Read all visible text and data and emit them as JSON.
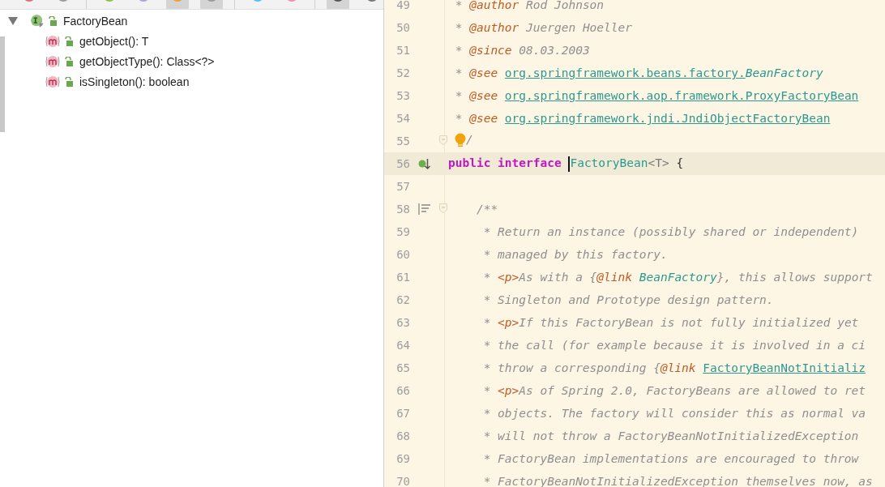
{
  "structure_toolbar": [
    {
      "kind": "circle",
      "selected": false
    },
    {
      "kind": "circle",
      "selected": false
    },
    {
      "kind": "circle",
      "selected": false
    },
    {
      "kind": "circle",
      "selected": false
    },
    {
      "kind": "circle",
      "selected": true
    },
    {
      "kind": "circle",
      "selected": true
    },
    {
      "kind": "circle",
      "selected": false
    },
    {
      "kind": "circle",
      "selected": false
    },
    {
      "kind": "circle",
      "selected": true
    },
    {
      "kind": "circle",
      "selected": false
    }
  ],
  "structure": {
    "label": "FactoryBean",
    "kind": "interface",
    "expanded": true,
    "children": [
      {
        "label": "getObject(): T",
        "kind": "method"
      },
      {
        "label": "getObjectType(): Class<?>",
        "kind": "method"
      },
      {
        "label": "isSingleton(): boolean",
        "kind": "method"
      }
    ]
  },
  "editor": {
    "lines": [
      {
        "number": "49",
        "current": false,
        "fold": false,
        "segments": [
          {
            "kind": "comment",
            "text": " * "
          },
          {
            "kind": "tag",
            "text": "@author"
          },
          {
            "kind": "comment",
            "text": " Rod Johnson"
          }
        ]
      },
      {
        "number": "50",
        "current": false,
        "fold": false,
        "segments": [
          {
            "kind": "comment",
            "text": " * "
          },
          {
            "kind": "tag",
            "text": "@author"
          },
          {
            "kind": "comment",
            "text": " Juergen Hoeller"
          }
        ]
      },
      {
        "number": "51",
        "current": false,
        "fold": false,
        "segments": [
          {
            "kind": "comment",
            "text": " * "
          },
          {
            "kind": "tag",
            "text": "@since"
          },
          {
            "kind": "comment",
            "text": " 08.03.2003"
          }
        ]
      },
      {
        "number": "52",
        "current": false,
        "fold": false,
        "segments": [
          {
            "kind": "comment",
            "text": " * "
          },
          {
            "kind": "tag",
            "text": "@see "
          },
          {
            "kind": "link",
            "text": "org.springframework.beans.factory."
          },
          {
            "kind": "ref",
            "text": "BeanFactory"
          }
        ]
      },
      {
        "number": "53",
        "current": false,
        "fold": false,
        "segments": [
          {
            "kind": "comment",
            "text": " * "
          },
          {
            "kind": "tag",
            "text": "@see "
          },
          {
            "kind": "link",
            "text": "org.springframework.aop.framework.ProxyFactoryBean"
          }
        ]
      },
      {
        "number": "54",
        "current": false,
        "fold": false,
        "segments": [
          {
            "kind": "comment",
            "text": " * "
          },
          {
            "kind": "tag",
            "text": "@see "
          },
          {
            "kind": "link",
            "text": "org.springframework.jndi.JndiObjectFactoryBean"
          }
        ]
      },
      {
        "number": "55",
        "current": false,
        "fold": true,
        "segments": [
          {
            "kind": "bulb"
          },
          {
            "kind": "comment",
            "text": "/"
          }
        ]
      },
      {
        "number": "56",
        "current": true,
        "fold": false,
        "gutter": {
          "kind": "implemented"
        },
        "segments": [
          {
            "kind": "keyword",
            "text": "public "
          },
          {
            "kind": "keyword",
            "text": "interface "
          },
          {
            "kind": "caret"
          },
          {
            "kind": "type",
            "text": "FactoryBean"
          },
          {
            "kind": "generic",
            "text": "<T>"
          },
          {
            "kind": "plain",
            "text": " {"
          }
        ]
      },
      {
        "number": "57",
        "current": false,
        "fold": false
      },
      {
        "number": "58",
        "current": false,
        "fold": true,
        "gutter": {
          "kind": "doc"
        },
        "segments": [
          {
            "kind": "comment",
            "text": "    /**"
          }
        ]
      },
      {
        "number": "59",
        "current": false,
        "fold": false,
        "segments": [
          {
            "kind": "comment",
            "text": "     * Return an instance (possibly shared or independent)"
          }
        ]
      },
      {
        "number": "60",
        "current": false,
        "fold": false,
        "segments": [
          {
            "kind": "comment",
            "text": "     * managed by this factory."
          }
        ]
      },
      {
        "number": "61",
        "current": false,
        "fold": false,
        "segments": [
          {
            "kind": "comment",
            "text": "     * "
          },
          {
            "kind": "html",
            "text": "<p>"
          },
          {
            "kind": "comment",
            "text": "As with a {"
          },
          {
            "kind": "tag",
            "text": "@link "
          },
          {
            "kind": "ref",
            "text": "BeanFactory"
          },
          {
            "kind": "comment",
            "text": "}, this allows support"
          }
        ]
      },
      {
        "number": "62",
        "current": false,
        "fold": false,
        "segments": [
          {
            "kind": "comment",
            "text": "     * Singleton and Prototype design pattern."
          }
        ]
      },
      {
        "number": "63",
        "current": false,
        "fold": false,
        "segments": [
          {
            "kind": "comment",
            "text": "     * "
          },
          {
            "kind": "html",
            "text": "<p>"
          },
          {
            "kind": "comment",
            "text": "If this FactoryBean is not fully initialized yet"
          }
        ]
      },
      {
        "number": "64",
        "current": false,
        "fold": false,
        "segments": [
          {
            "kind": "comment",
            "text": "     * the call (for example because it is involved in a ci"
          }
        ]
      },
      {
        "number": "65",
        "current": false,
        "fold": false,
        "segments": [
          {
            "kind": "comment",
            "text": "     * throw a corresponding {"
          },
          {
            "kind": "tag",
            "text": "@link "
          },
          {
            "kind": "link",
            "text": "FactoryBeanNotInitializ"
          }
        ]
      },
      {
        "number": "66",
        "current": false,
        "fold": false,
        "segments": [
          {
            "kind": "comment",
            "text": "     * "
          },
          {
            "kind": "html",
            "text": "<p>"
          },
          {
            "kind": "comment",
            "text": "As of Spring 2.0, FactoryBeans are allowed to ret"
          }
        ]
      },
      {
        "number": "67",
        "current": false,
        "fold": false,
        "segments": [
          {
            "kind": "comment",
            "text": "     * objects. The factory will consider this as normal va"
          }
        ]
      },
      {
        "number": "68",
        "current": false,
        "fold": false,
        "segments": [
          {
            "kind": "comment",
            "text": "     * will not throw a FactoryBeanNotInitializedException"
          }
        ]
      },
      {
        "number": "69",
        "current": false,
        "fold": false,
        "segments": [
          {
            "kind": "comment",
            "text": "     * FactoryBean implementations are encouraged to throw"
          }
        ]
      },
      {
        "number": "70",
        "current": false,
        "fold": false,
        "segments": [
          {
            "kind": "comment",
            "text": "     * FactoryBeanNotInitializedException themselves now, as"
          }
        ]
      }
    ]
  }
}
